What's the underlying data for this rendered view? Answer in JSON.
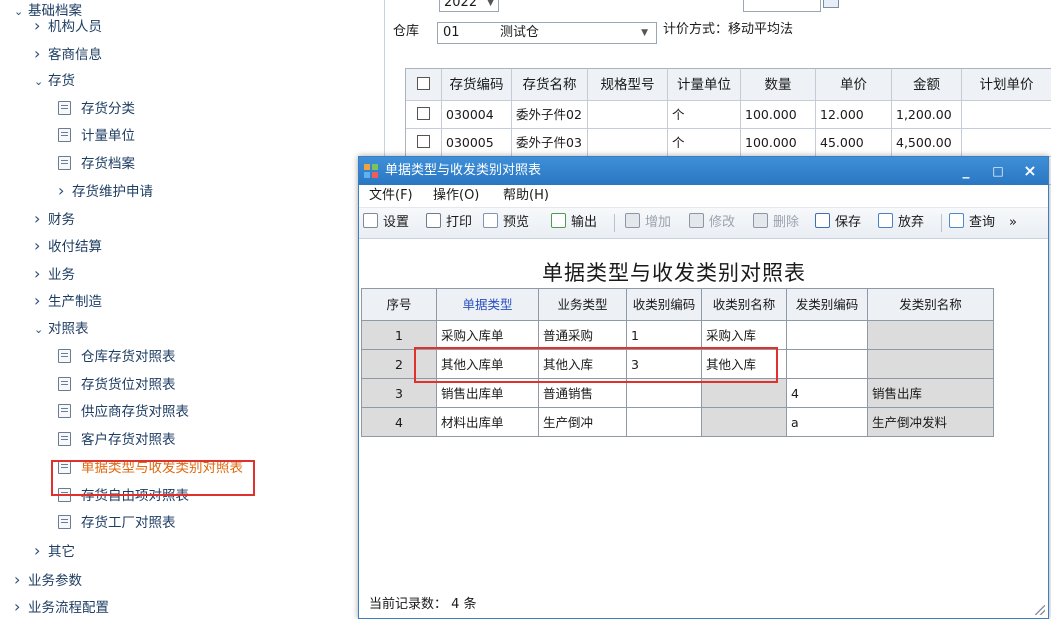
{
  "tree": {
    "root": "基础档案",
    "items": [
      {
        "label": "机构人员",
        "type": "folder",
        "expanded": false
      },
      {
        "label": "客商信息",
        "type": "folder",
        "expanded": false
      },
      {
        "label": "存货",
        "type": "folder",
        "expanded": true
      },
      {
        "label": "存货分类",
        "type": "leaf"
      },
      {
        "label": "计量单位",
        "type": "leaf"
      },
      {
        "label": "存货档案",
        "type": "leaf"
      },
      {
        "label": "存货维护申请",
        "type": "folder",
        "expanded": false
      },
      {
        "label": "财务",
        "type": "folder",
        "expanded": false
      },
      {
        "label": "收付结算",
        "type": "folder",
        "expanded": false
      },
      {
        "label": "业务",
        "type": "folder",
        "expanded": false
      },
      {
        "label": "生产制造",
        "type": "folder",
        "expanded": false
      },
      {
        "label": "对照表",
        "type": "folder",
        "expanded": true
      },
      {
        "label": "仓库存货对照表",
        "type": "leaf"
      },
      {
        "label": "存货货位对照表",
        "type": "leaf"
      },
      {
        "label": "供应商存货对照表",
        "type": "leaf"
      },
      {
        "label": "客户存货对照表",
        "type": "leaf"
      },
      {
        "label": "单据类型与收发类别对照表",
        "type": "leaf",
        "active": true
      },
      {
        "label": "存货自由项对照表",
        "type": "leaf"
      },
      {
        "label": "存货工厂对照表",
        "type": "leaf"
      },
      {
        "label": "其它",
        "type": "folder",
        "expanded": false
      }
    ],
    "bottom": [
      "业务参数",
      "业务流程配置"
    ]
  },
  "voucher": {
    "year_value": "2022",
    "warehouse_label": "仓库",
    "warehouse_code": "01",
    "warehouse_name": "测试仓",
    "pricing_label": "计价方式：移动平均法",
    "columns": [
      "存货编码",
      "存货名称",
      "规格型号",
      "计量单位",
      "数量",
      "单价",
      "金额",
      "计划单价"
    ],
    "rows": [
      [
        "030004",
        "委外子件02",
        "",
        "个",
        "100.000",
        "12.000",
        "1,200.00",
        ""
      ],
      [
        "030005",
        "委外子件03",
        "",
        "个",
        "100.000",
        "45.000",
        "4,500.00",
        ""
      ]
    ]
  },
  "dialog": {
    "title": "单据类型与收发类别对照表",
    "window_buttons": [
      "_",
      "□",
      "×"
    ],
    "menu": [
      "文件(F)",
      "操作(O)",
      "帮助(H)"
    ],
    "toolbar": [
      {
        "label": "设置",
        "icon": "settings-icon",
        "enabled": true
      },
      {
        "label": "打印",
        "icon": "print-icon",
        "enabled": true
      },
      {
        "label": "预览",
        "icon": "preview-icon",
        "enabled": true
      },
      {
        "label": "输出",
        "icon": "export-icon",
        "enabled": true
      },
      {
        "label": "增加",
        "icon": "add-icon",
        "enabled": false
      },
      {
        "label": "修改",
        "icon": "edit-icon",
        "enabled": false
      },
      {
        "label": "删除",
        "icon": "delete-icon",
        "enabled": false
      },
      {
        "label": "保存",
        "icon": "save-icon",
        "enabled": true
      },
      {
        "label": "放弃",
        "icon": "discard-icon",
        "enabled": true
      },
      {
        "label": "查询",
        "icon": "query-icon",
        "enabled": true
      }
    ],
    "overflow": "»",
    "sheet_title": "单据类型与收发类别对照表",
    "columns": [
      "序号",
      "单据类型",
      "业务类型",
      "收类别编码",
      "收类别名称",
      "发类别编码",
      "发类别名称"
    ],
    "rows": [
      [
        "1",
        "采购入库单",
        "普通采购",
        "1",
        "采购入库",
        "",
        ""
      ],
      [
        "2",
        "其他入库单",
        "其他入库",
        "3",
        "其他入库",
        "",
        ""
      ],
      [
        "3",
        "销售出库单",
        "普通销售",
        "",
        "",
        "4",
        "销售出库"
      ],
      [
        "4",
        "材料出库单",
        "生产倒冲",
        "",
        "",
        "a",
        "生产倒冲发料"
      ]
    ],
    "status": "当前记录数： 4 条"
  },
  "colors": {
    "accent": "#2a76c2",
    "highlight": "#e0312d",
    "active_item": "#e06a10"
  }
}
